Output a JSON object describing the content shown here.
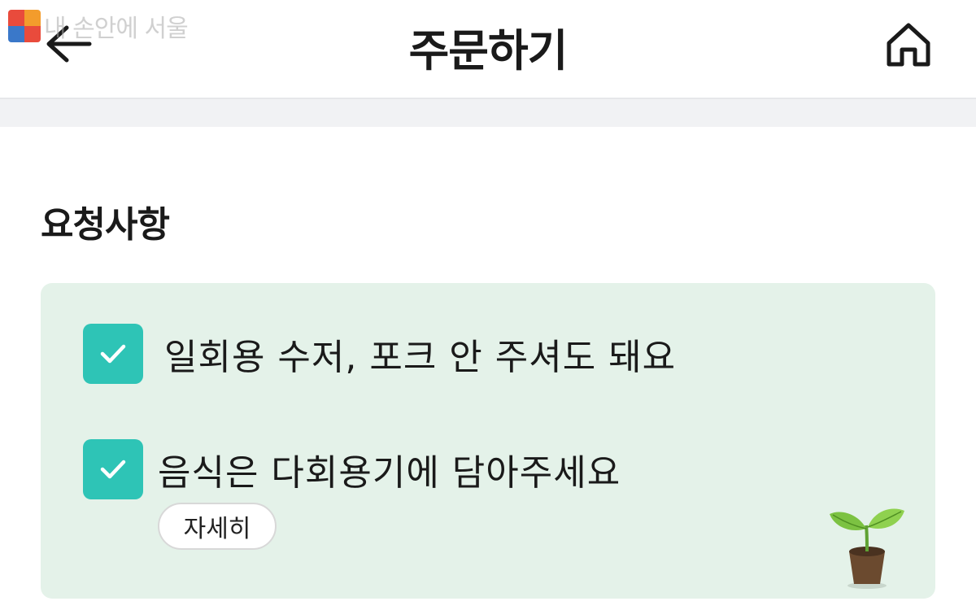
{
  "watermark": {
    "text": "내 손안에 서울"
  },
  "header": {
    "title": "주문하기",
    "back_icon": "arrow-left-icon",
    "home_icon": "home-icon"
  },
  "section": {
    "title": "요청사항"
  },
  "requests": [
    {
      "label": "일회용 수저, 포크 안 주셔도 돼요",
      "checked": true
    },
    {
      "label": "음식은 다회용기에 담아주세요",
      "checked": true
    }
  ],
  "detail_button": {
    "label": "자세히"
  },
  "colors": {
    "accent": "#2ec4b6",
    "card_bg": "#e4f2e9",
    "divider": "#f1f2f4"
  }
}
